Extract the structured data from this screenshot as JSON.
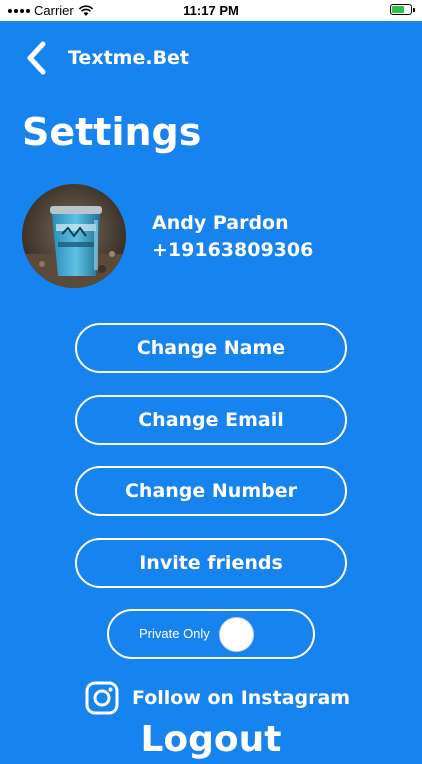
{
  "status_bar": {
    "carrier": "Carrier",
    "time": "11:17 PM",
    "battery_level": 0.7,
    "battery_color": "#2fc144"
  },
  "nav": {
    "back_icon": "chevron-left-icon",
    "title": "Textme.Bet"
  },
  "page": {
    "title": "Settings",
    "background": "#1683ee"
  },
  "profile": {
    "name": "Andy Pardon",
    "phone": "+19163809306",
    "avatar_icon": "avatar-photo"
  },
  "actions": {
    "change_name": "Change Name",
    "change_email": "Change Email",
    "change_number": "Change Number",
    "invite_friends": "Invite friends"
  },
  "privacy_toggle": {
    "label": "Private Only",
    "on": true
  },
  "instagram": {
    "icon": "instagram-icon",
    "label": "Follow on Instagram"
  },
  "logout_label": "Logout"
}
